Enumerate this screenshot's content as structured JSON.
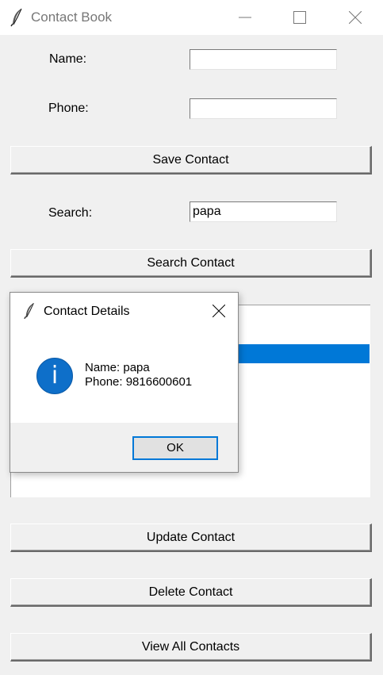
{
  "window": {
    "title": "Contact Book",
    "icon": "feather-icon",
    "controls": [
      "minimize-icon",
      "maximize-icon",
      "close-icon"
    ]
  },
  "form": {
    "name_label": "Name:",
    "name_value": "",
    "phone_label": "Phone:",
    "phone_value": "",
    "search_label": "Search:",
    "search_value": "papa"
  },
  "buttons": {
    "save": "Save Contact",
    "search": "Search Contact",
    "update": "Update Contact",
    "delete": "Delete Contact",
    "view_all": "View All Contacts"
  },
  "listbox": {
    "items": [],
    "selected_color": "#0078d7"
  },
  "dialog": {
    "title": "Contact Details",
    "icon": "info-icon",
    "icon_glyph": "i",
    "message_line1": "Name: papa",
    "message_line2": "Phone: 9816600601",
    "ok_label": "OK"
  },
  "colors": {
    "accent": "#0078d7",
    "info_icon": "#0e6fc9",
    "window_bg": "#f0f0f0"
  }
}
